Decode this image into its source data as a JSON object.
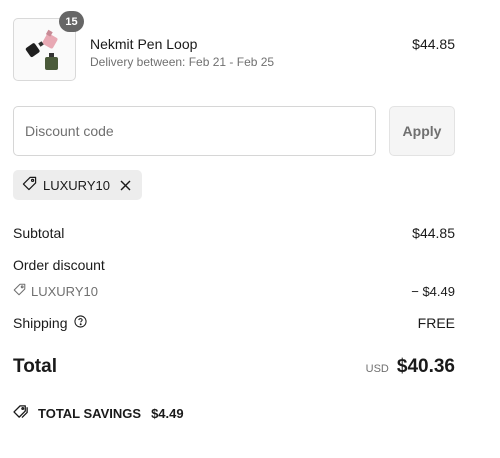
{
  "line_item": {
    "quantity": "15",
    "name": "Nekmit Pen Loop",
    "delivery": "Delivery between: Feb 21 - Feb 25",
    "price": "$44.85",
    "image_icon": "product-thumbnail"
  },
  "discount": {
    "placeholder": "Discount code",
    "value": "",
    "apply_label": "Apply",
    "applied_code": "LUXURY10",
    "tag_icon": "tag-icon",
    "remove_icon": "close-icon"
  },
  "summary": {
    "subtotal_label": "Subtotal",
    "subtotal_value": "$44.85",
    "order_discount_label": "Order discount",
    "discount_code": "LUXURY10",
    "discount_value": "− $4.49",
    "shipping_label": "Shipping",
    "shipping_value": "FREE",
    "shipping_info_icon": "question-circle-icon",
    "total_label": "Total",
    "currency": "USD",
    "total_value": "$40.36"
  },
  "savings": {
    "label": "TOTAL SAVINGS",
    "amount": "$4.49",
    "icon": "tags-icon"
  },
  "colors": {
    "text": "#1a1a1a",
    "muted": "#707070",
    "chip_bg": "#ededed",
    "badge_bg": "#666666",
    "border": "#d6d6d6"
  }
}
